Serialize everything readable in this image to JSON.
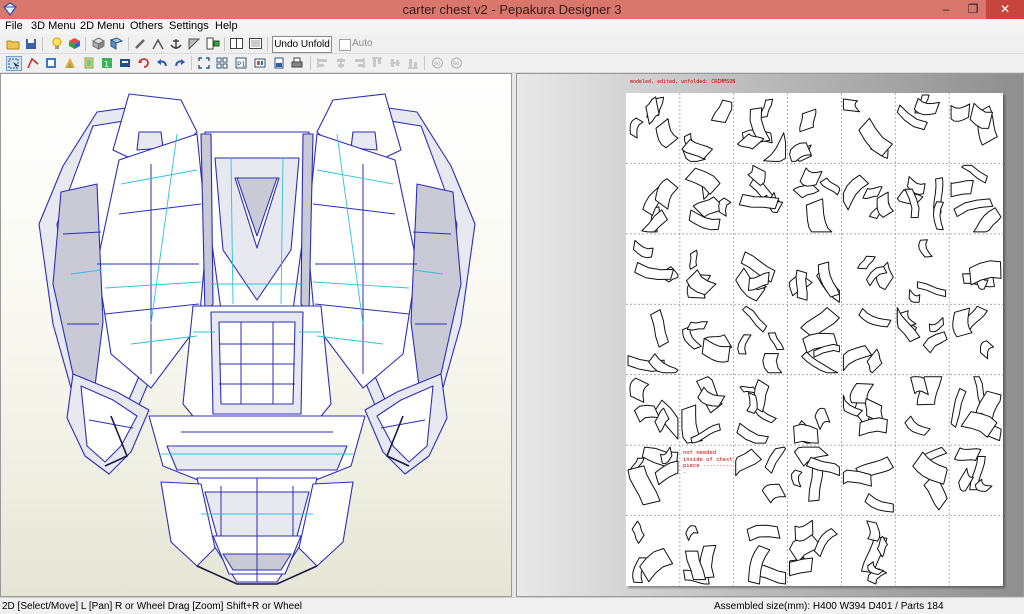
{
  "window": {
    "title": "carter chest v2 - Pepakura Designer 3",
    "minimize_glyph": "–",
    "maximize_glyph": "❐",
    "close_glyph": "✕"
  },
  "menu": [
    "File",
    "3D Menu",
    "2D Menu",
    "Others",
    "Settings",
    "Help"
  ],
  "toolbar": {
    "undo_unfold_label": "Undo Unfold",
    "auto_label": "Auto",
    "auto_checked": false
  },
  "sheet": {
    "credit_text": "modeled, edited, unfolded: CRIMMSON",
    "note_lines": [
      "not needed",
      "inside of chest",
      "piece ----------"
    ]
  },
  "status": {
    "left": "2D [Select/Move] L [Pan] R or Wheel Drag [Zoom] Shift+R or Wheel",
    "right": "Assembled size(mm): H400 W394 D401 / Parts 184"
  },
  "colors": {
    "titlebar": "#d9776c",
    "close_button": "#c7453a",
    "model_edge": "#2b2fb8",
    "model_fold_line": "#29c4d8",
    "note_text": "#c00000"
  }
}
